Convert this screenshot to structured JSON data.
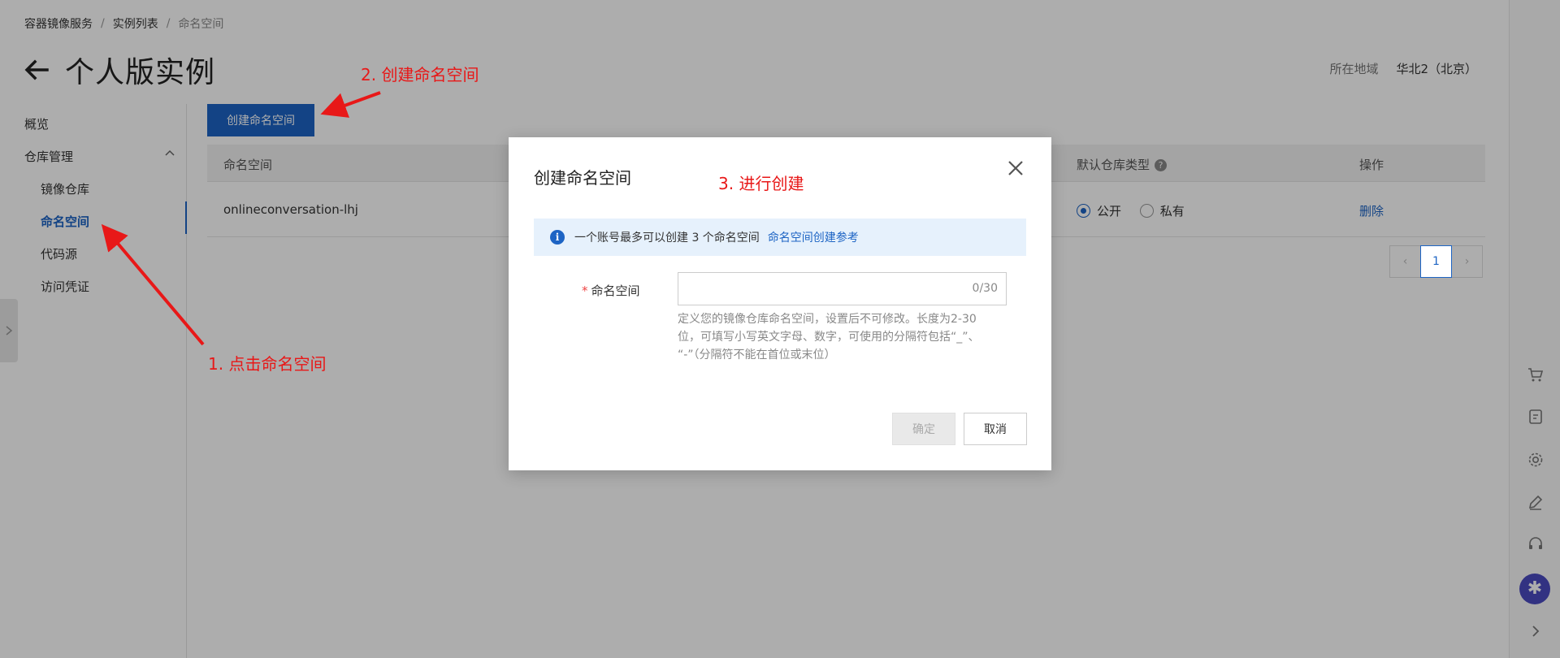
{
  "breadcrumb": {
    "items": [
      "容器镜像服务",
      "实例列表",
      "命名空间"
    ],
    "separator": "/"
  },
  "header": {
    "title": "个人版实例",
    "region_label": "所在地域",
    "region_value": "华北2（北京）"
  },
  "sidebar": {
    "overview": "概览",
    "repo_management": "仓库管理",
    "items": [
      "镜像仓库",
      "命名空间",
      "代码源",
      "访问凭证"
    ],
    "active_item": "命名空间"
  },
  "content": {
    "create_button": "创建命名空间",
    "columns": [
      "命名空间",
      "默认仓库类型",
      "操作"
    ],
    "rows": [
      {
        "namespace": "onlineconversation-lhj",
        "public_label": "公开",
        "private_label": "私有",
        "action": "删除"
      }
    ],
    "pager": {
      "current": "1",
      "prev": "‹",
      "next": "›"
    }
  },
  "modal": {
    "title": "创建命名空间",
    "info_text": "一个账号最多可以创建 3 个命名空间",
    "info_link": "命名空间创建参考",
    "field_label": "命名空间",
    "required_mark": "*",
    "input_value": "",
    "counter": "0/30",
    "help_line1": "定义您的镜像仓库命名空间，设置后不可修改。长度为2-30",
    "help_line2": "位，可填写小写英文字母、数字，可使用的分隔符包括“_”、",
    "help_line3": "“-”（分隔符不能在首位或末位）",
    "ok_button": "确定",
    "cancel_button": "取消"
  },
  "annotations": {
    "step1": "1. 点击命名空间",
    "step2": "2. 创建命名空间",
    "step3": "3. 进行创建",
    "color": "#e81818"
  },
  "colors": {
    "primary": "#1d64c4",
    "info_bg": "#e6f1fc"
  }
}
